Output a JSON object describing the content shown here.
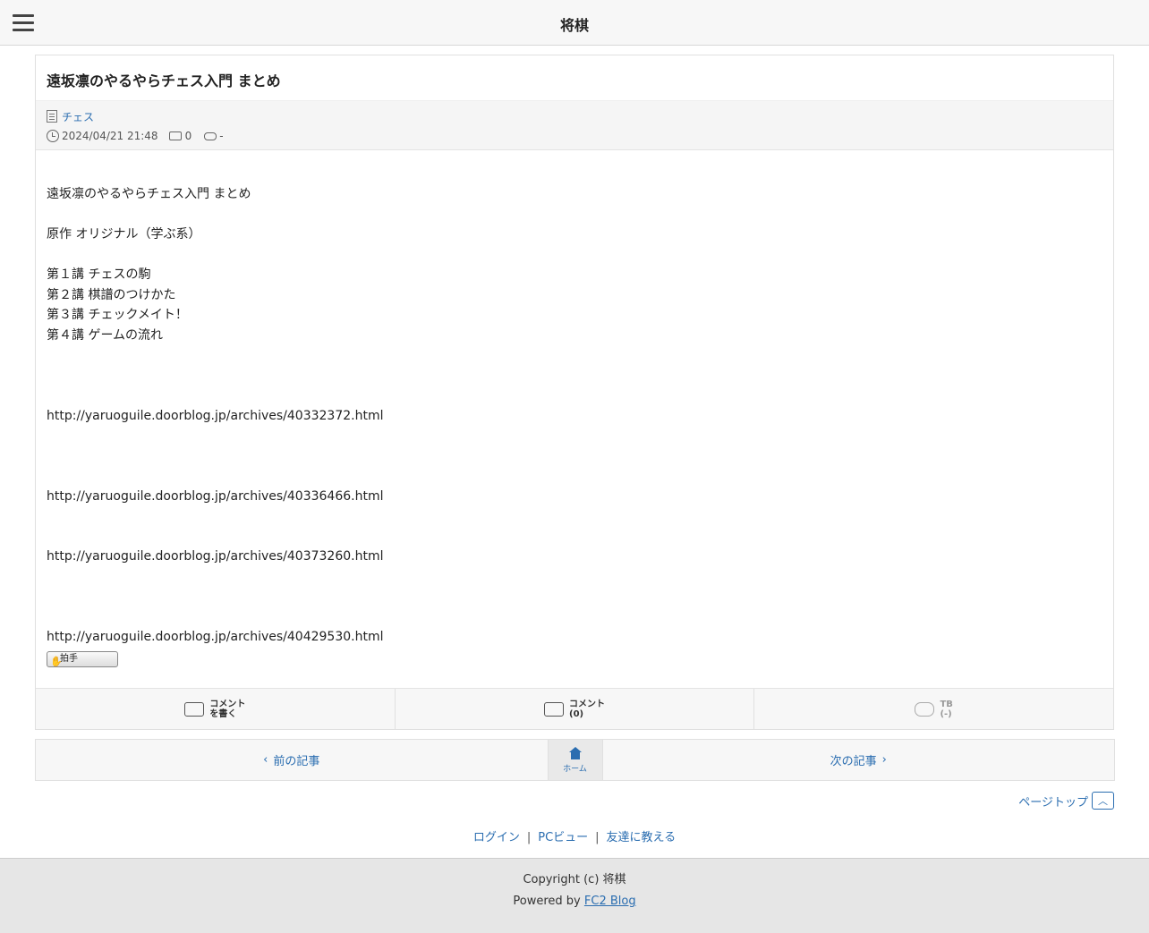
{
  "header": {
    "title": "将棋"
  },
  "article": {
    "title": "遠坂凛のやるやらチェス入門 まとめ",
    "category": "チェス",
    "datetime": "2024/04/21 21:48",
    "comment_count": "0",
    "trackback_count": "-",
    "body_lines": [
      "遠坂凛のやるやらチェス入門 まとめ",
      "",
      "原作 オリジナル（学ぶ系）",
      "",
      "第１講 チェスの駒",
      "第２講 棋譜のつけかた",
      "第３講 チェックメイト！",
      "第４講 ゲームの流れ",
      "",
      "",
      "",
      "http://yaruoguile.doorblog.jp/archives/40332372.html",
      "",
      "",
      "",
      "http://yaruoguile.doorblog.jp/archives/40336466.html",
      "",
      "",
      "http://yaruoguile.doorblog.jp/archives/40373260.html",
      "",
      "",
      "",
      "http://yaruoguile.doorblog.jp/archives/40429530.html"
    ],
    "clap_label": "拍手",
    "actions": {
      "write_comment_1": "コメント",
      "write_comment_2": "を書く",
      "comments_1": "コメント",
      "comments_2": "(0)",
      "tb_1": "TB",
      "tb_2": "(-)"
    }
  },
  "nav": {
    "prev": "前の記事",
    "home": "ホーム",
    "next": "次の記事"
  },
  "pagetop": {
    "label": "ページトップ"
  },
  "links": {
    "login": "ログイン",
    "pc_view": "PCビュー",
    "tell_friend": "友達に教える"
  },
  "footer": {
    "copyright": "Copyright (c) 将棋",
    "powered_prefix": "Powered by",
    "powered_link": "FC2 Blog"
  }
}
